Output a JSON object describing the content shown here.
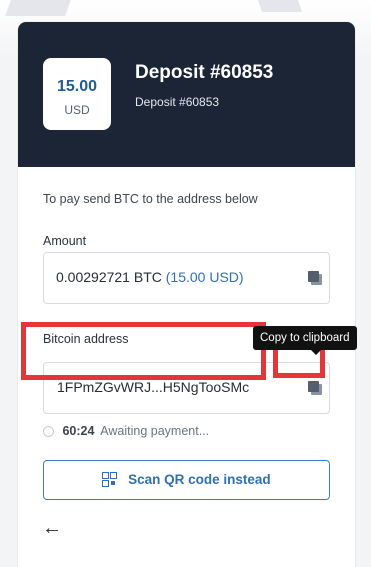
{
  "header": {
    "amount": "15.00",
    "currency": "USD",
    "title": "Deposit #60853",
    "subtitle": "Deposit #60853"
  },
  "instruction": "To pay send BTC to the address below",
  "amount_field": {
    "label": "Amount",
    "crypto_value": "0.00292721 BTC",
    "fiat_value": "(15.00 USD)"
  },
  "address_field": {
    "label": "Bitcoin address",
    "value": "1FPmZGvWRJ...H5NgTooSMc"
  },
  "tooltip": "Copy to clipboard",
  "status": {
    "timer": "60:24",
    "text": "Awaiting payment..."
  },
  "qr_button_label": "Scan QR code instead",
  "back_arrow": "←",
  "icons": {
    "copy": "copy-icon",
    "qr": "qr-code-icon",
    "back": "arrow-left-icon",
    "spinner": "spinner-icon"
  },
  "colors": {
    "header_bg": "#1b2536",
    "accent": "#2f6fba",
    "highlight": "#e63538",
    "tooltip_bg": "#111111"
  }
}
